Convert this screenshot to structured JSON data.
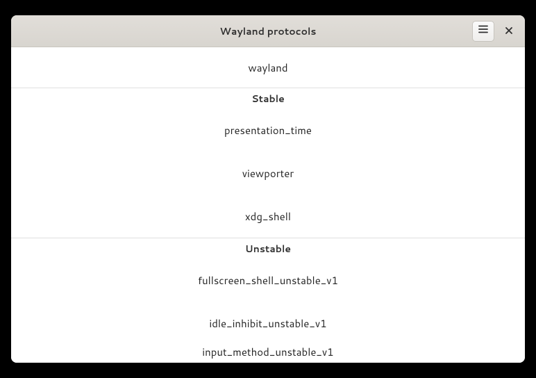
{
  "header": {
    "title": "Wayland protocols"
  },
  "core": {
    "item": "wayland"
  },
  "sections": [
    {
      "title": "Stable",
      "items": [
        "presentation_time",
        "viewporter",
        "xdg_shell"
      ]
    },
    {
      "title": "Unstable",
      "items": [
        "fullscreen_shell_unstable_v1",
        "idle_inhibit_unstable_v1",
        "input_method_unstable_v1"
      ]
    }
  ]
}
